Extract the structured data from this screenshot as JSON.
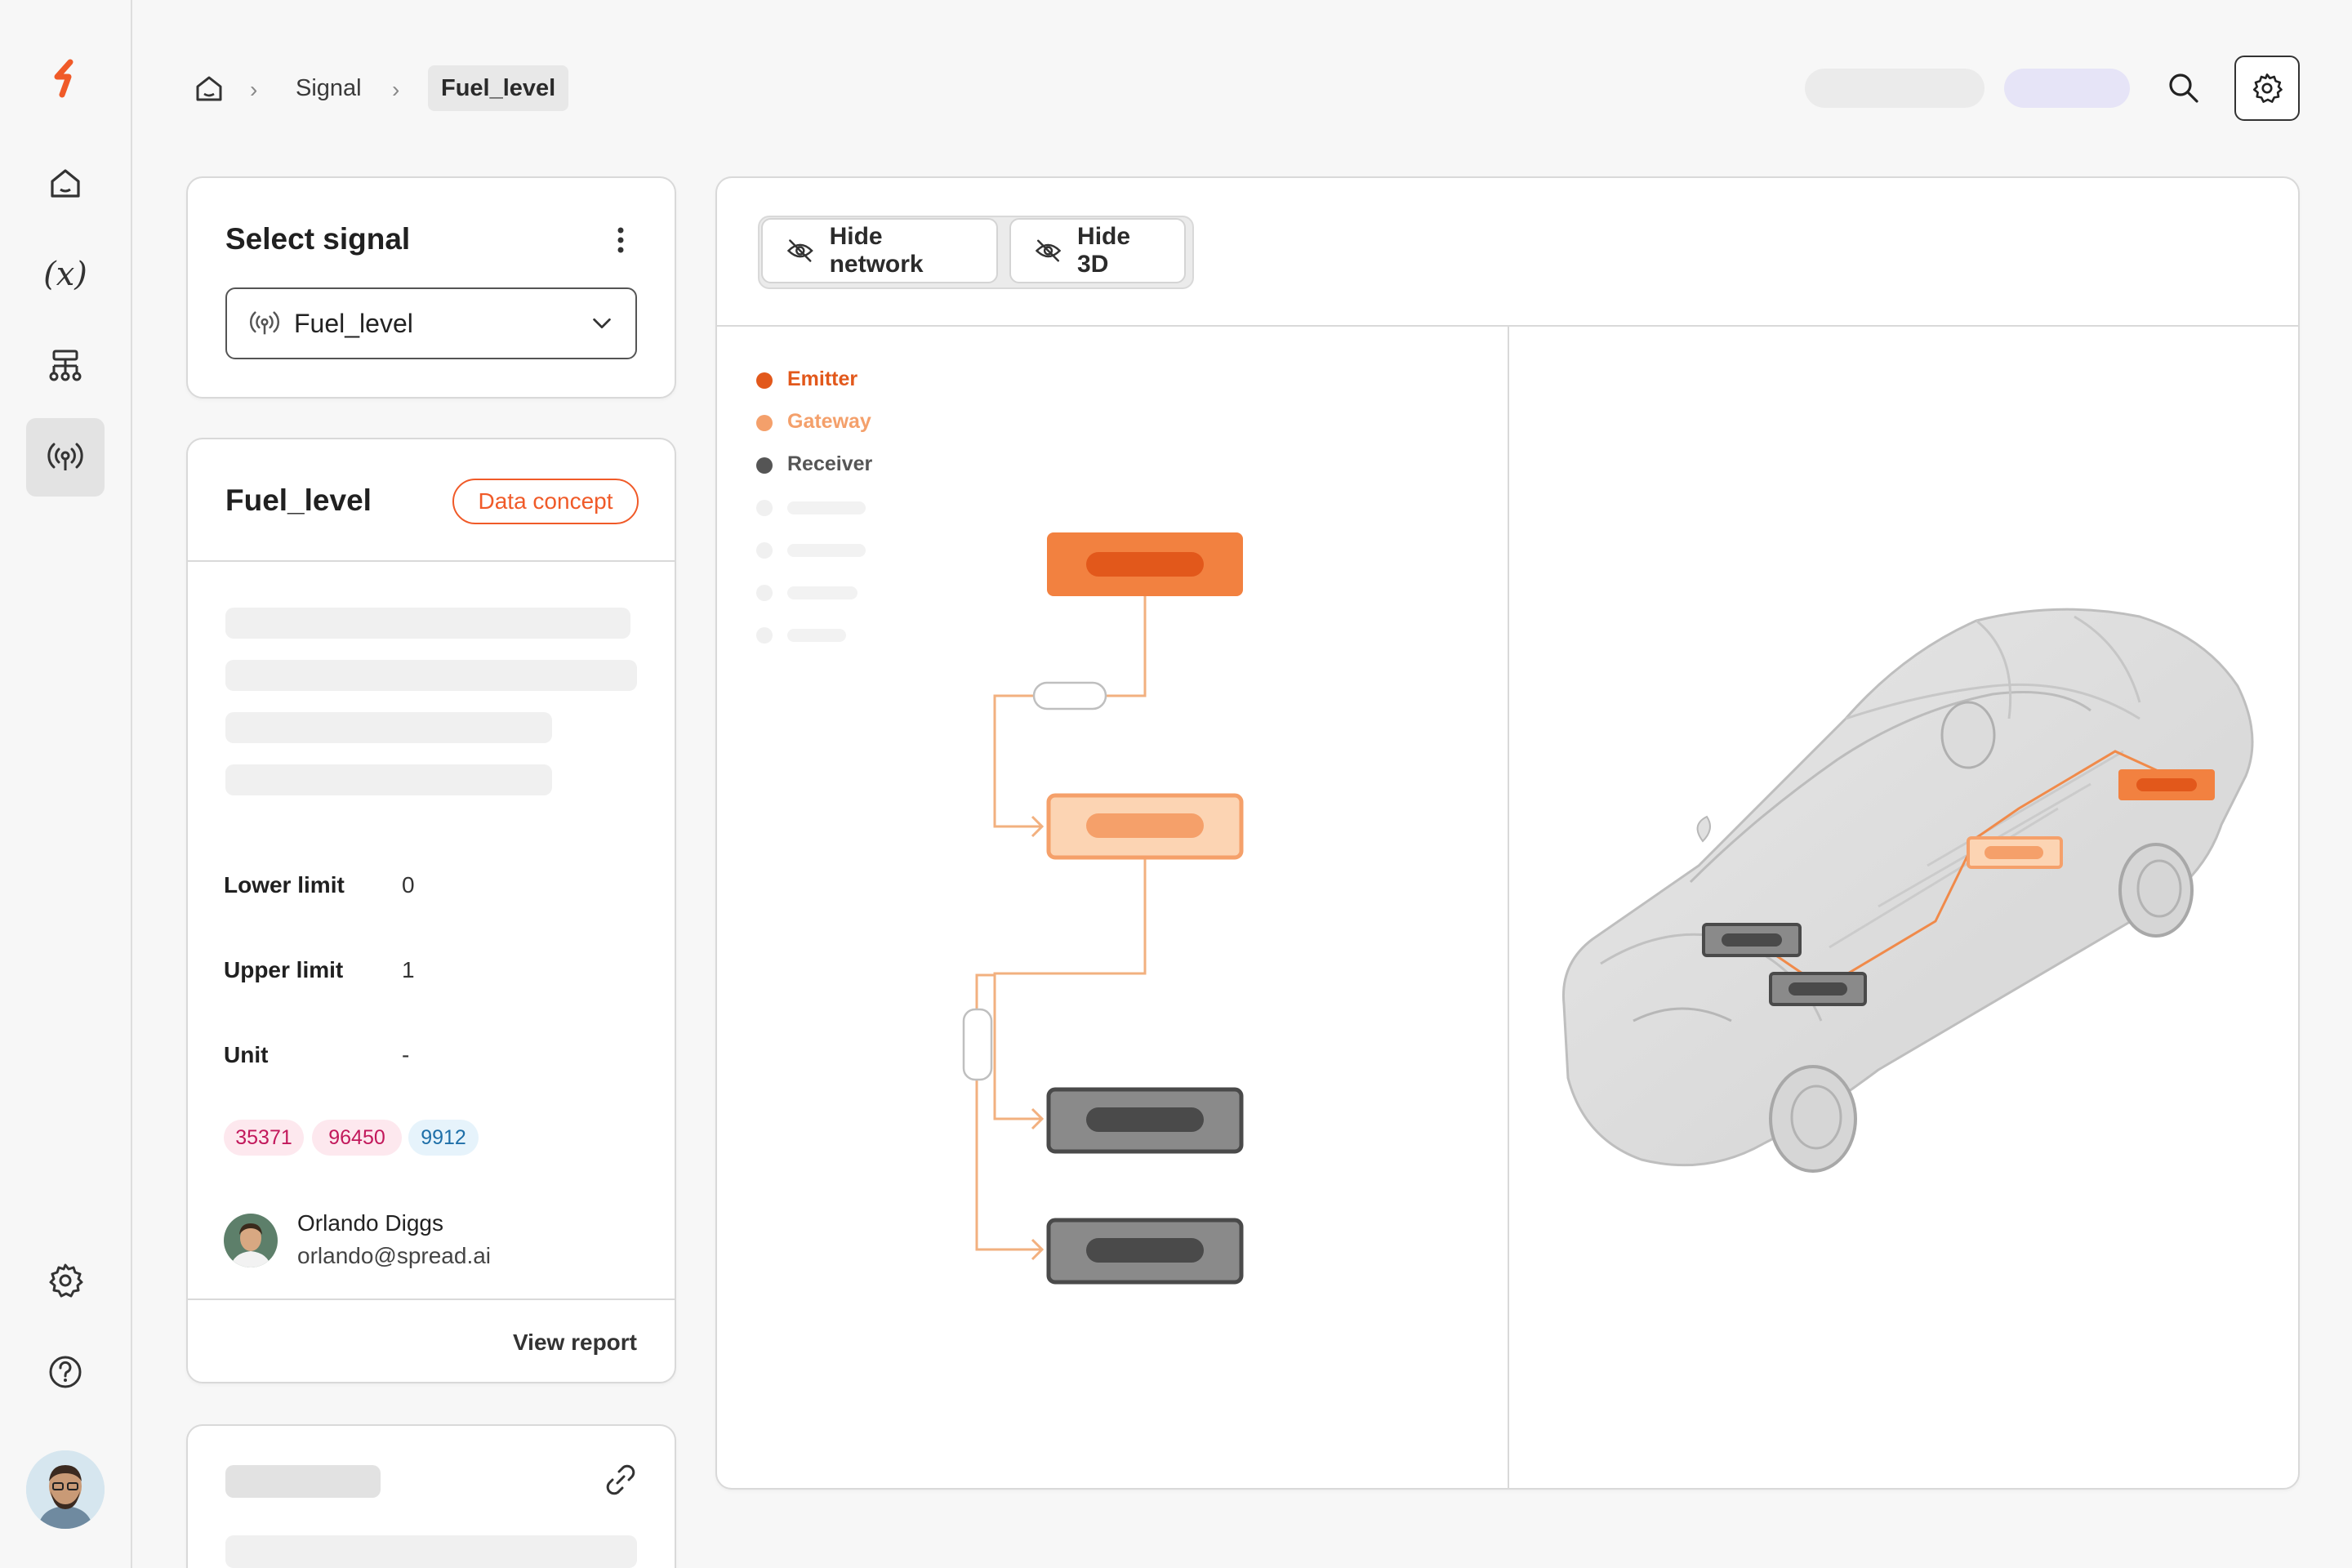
{
  "breadcrumb": {
    "home_icon": "home-icon",
    "items": [
      "Signal",
      "Fuel_level"
    ]
  },
  "sidebar": {
    "items": [
      {
        "name": "logo-icon"
      },
      {
        "name": "home-icon"
      },
      {
        "name": "variable-icon",
        "label": "(x)"
      },
      {
        "name": "network-tree-icon"
      },
      {
        "name": "signal-broadcast-icon",
        "active": true
      },
      {
        "name": "gear-icon"
      },
      {
        "name": "help-icon"
      },
      {
        "name": "user-avatar"
      }
    ]
  },
  "select_card": {
    "title": "Select signal",
    "selected_value": "Fuel_level",
    "icons": [
      "more-vertical-icon",
      "signal-broadcast-icon",
      "chevron-down-icon"
    ]
  },
  "detail_card": {
    "title": "Fuel_level",
    "badge": "Data concept",
    "fields": [
      {
        "label": "Lower limit",
        "value": "0"
      },
      {
        "label": "Upper limit",
        "value": "1"
      },
      {
        "label": "Unit",
        "value": "-"
      }
    ],
    "tags": [
      {
        "text": "35371",
        "color": "#c2185b",
        "bg": "#fde8ee"
      },
      {
        "text": "96450",
        "color": "#c2185b",
        "bg": "#fde8ee"
      },
      {
        "text": "9912",
        "color": "#1e6fa8",
        "bg": "#e6f3fb"
      }
    ],
    "owner": {
      "name": "Orlando Diggs",
      "email": "orlando@spread.ai"
    },
    "action": "View report"
  },
  "viewer": {
    "buttons": [
      {
        "label": "Hide network",
        "icon": "eye-off-icon"
      },
      {
        "label": "Hide 3D",
        "icon": "eye-off-icon"
      }
    ],
    "legend": [
      {
        "label": "Emitter",
        "color": "#e2581b"
      },
      {
        "label": "Gateway",
        "color": "#f4a06b"
      },
      {
        "label": "Receiver",
        "color": "#555555"
      }
    ]
  },
  "colors": {
    "accent": "#f05a28",
    "emitter": "#f07d3c",
    "gateway": "#fbc49a",
    "receiver": "#8a8a8a"
  }
}
